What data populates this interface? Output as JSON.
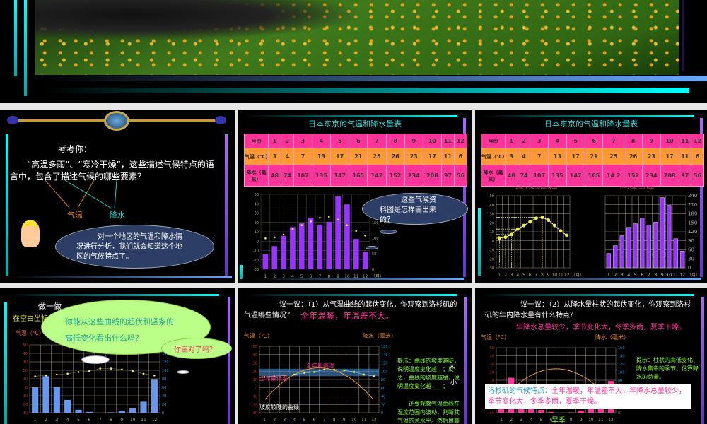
{
  "slide1": {
    "image": "meadow-with-yellow-flowers-photo"
  },
  "slide2": {
    "heading": "考考你：",
    "question": "“高温多雨”、“寒冷干燥”，这些描述气候特点的语言中，包含了描述气候的哪些要素？",
    "label_temp": "气温",
    "label_precip": "降水",
    "bubble": "对一个地区的气温和降水情况进行分析，我们就会知道这个地区的气候特点了。"
  },
  "tokyo_table": {
    "title": "日本东京的气温和降水量表",
    "row_month": "月份",
    "row_temp": "气温（℃）",
    "row_precip": "降水（毫米）",
    "months": [
      "1",
      "2",
      "3",
      "4",
      "5",
      "6",
      "7",
      "8",
      "9",
      "10",
      "11",
      "12"
    ],
    "temps": [
      "3",
      "4",
      "7",
      "13",
      "17",
      "21",
      "25",
      "26",
      "23",
      "17",
      "11",
      "6"
    ],
    "precip": [
      "48",
      "74",
      "107",
      "135",
      "147",
      "165",
      "142",
      "152",
      "234",
      "208",
      "97",
      "56"
    ],
    "precip_alt7": "14 2"
  },
  "slide3": {
    "bubble": "这些气候资料图是怎样画出来的？",
    "ylabel_l": "气温（℃）",
    "ylabel_r": "降水（毫米）",
    "xunit": "（月）"
  },
  "slide4": {
    "curve_title": "气温年变化曲线图",
    "bar_title": "降水量柱状图",
    "ylabel_l": "气温（℃）",
    "ylabel_r": "降水（毫米）",
    "xunit": "（月）"
  },
  "slide5": {
    "line1": "做一做",
    "line2": "在空白坐标",
    "bubble": "你能从这些曲线的起伏和竖条的高低变化看出什么吗？",
    "bubble2": "你画对了吗？",
    "ylabel_l": "气温（℃）"
  },
  "slide6": {
    "question": "议一议：（1）从气温曲线的起伏变化，你观察到洛杉矶的气温哪些情况？",
    "answer": "全年温暖，年温差不大。",
    "ylabel_l": "气温（℃）",
    "ylabel_r": "降水（毫米）",
    "max_label": "全年最高温",
    "min_label": "全年最低温",
    "steep_label": "坡度较陡的曲线",
    "hint": "提示：曲线的坡度越陡，说明温度变化越__；反之，曲线的坡度越缓，说明温度变化越____；",
    "hint_fill": "大",
    "hint_fill2": "小",
    "hint2": "还要观察气温曲线在温度范围内波动，判断其气温的总水平。然后用高温、温暖、凉"
  },
  "slide7": {
    "question": "议一议：（2）从降水量柱状的起伏变化，你观察到洛杉矶的年内降水量有什么特点？",
    "answer": "年降水总量较少，季节变化大，冬季多雨，夏季干燥。",
    "ylabel_l": "气温（℃）",
    "ylabel_r": "降水（毫米）",
    "hint": "提示：柱状的高低变化、降水集中的季节、估算降水的总量。",
    "summary_label": "洛杉矶的气候特点：",
    "summary": "全年温暖，年温差不大；年降水总量较少，季节变化大，冬季多雨，夏季干燥。",
    "dry_season": "旱季"
  },
  "chart_data": [
    {
      "type": "bar",
      "title": "日本东京的气温和降水量",
      "x": [
        1,
        2,
        3,
        4,
        5,
        6,
        7,
        8,
        9,
        10,
        11,
        12
      ],
      "series": [
        {
          "name": "气温（℃）",
          "type": "line",
          "values": [
            3,
            4,
            7,
            13,
            17,
            21,
            25,
            26,
            23,
            17,
            11,
            6
          ]
        },
        {
          "name": "降水（毫米）",
          "type": "bar",
          "values": [
            48,
            74,
            107,
            135,
            147,
            165,
            142,
            152,
            234,
            208,
            97,
            56
          ]
        }
      ],
      "ylim_left": [
        -30,
        50
      ],
      "ylim_right": [
        0,
        240
      ],
      "xlabel": "（月）"
    },
    {
      "type": "bar",
      "title": "洛杉矶气温和降水",
      "x": [
        1,
        2,
        3,
        4,
        5,
        6,
        7,
        8,
        9,
        10,
        11,
        12
      ],
      "series": [
        {
          "name": "气温（℃）",
          "type": "line",
          "values": [
            13,
            14,
            15,
            16,
            18,
            19,
            22,
            22,
            21,
            19,
            16,
            14
          ]
        },
        {
          "name": "降水（毫米）",
          "type": "bar",
          "values": [
            60,
            86,
            60,
            30,
            7,
            2,
            0,
            1,
            5,
            10,
            26,
            78
          ]
        }
      ],
      "ylim_left": [
        -30,
        50
      ],
      "ylim_right": [
        0,
        160
      ]
    }
  ],
  "colors": {
    "accent_cyan": "#00ffff",
    "bar_purple": "#9933ff",
    "table_pink": "#ff3399",
    "table_orange": "#ff9933"
  }
}
